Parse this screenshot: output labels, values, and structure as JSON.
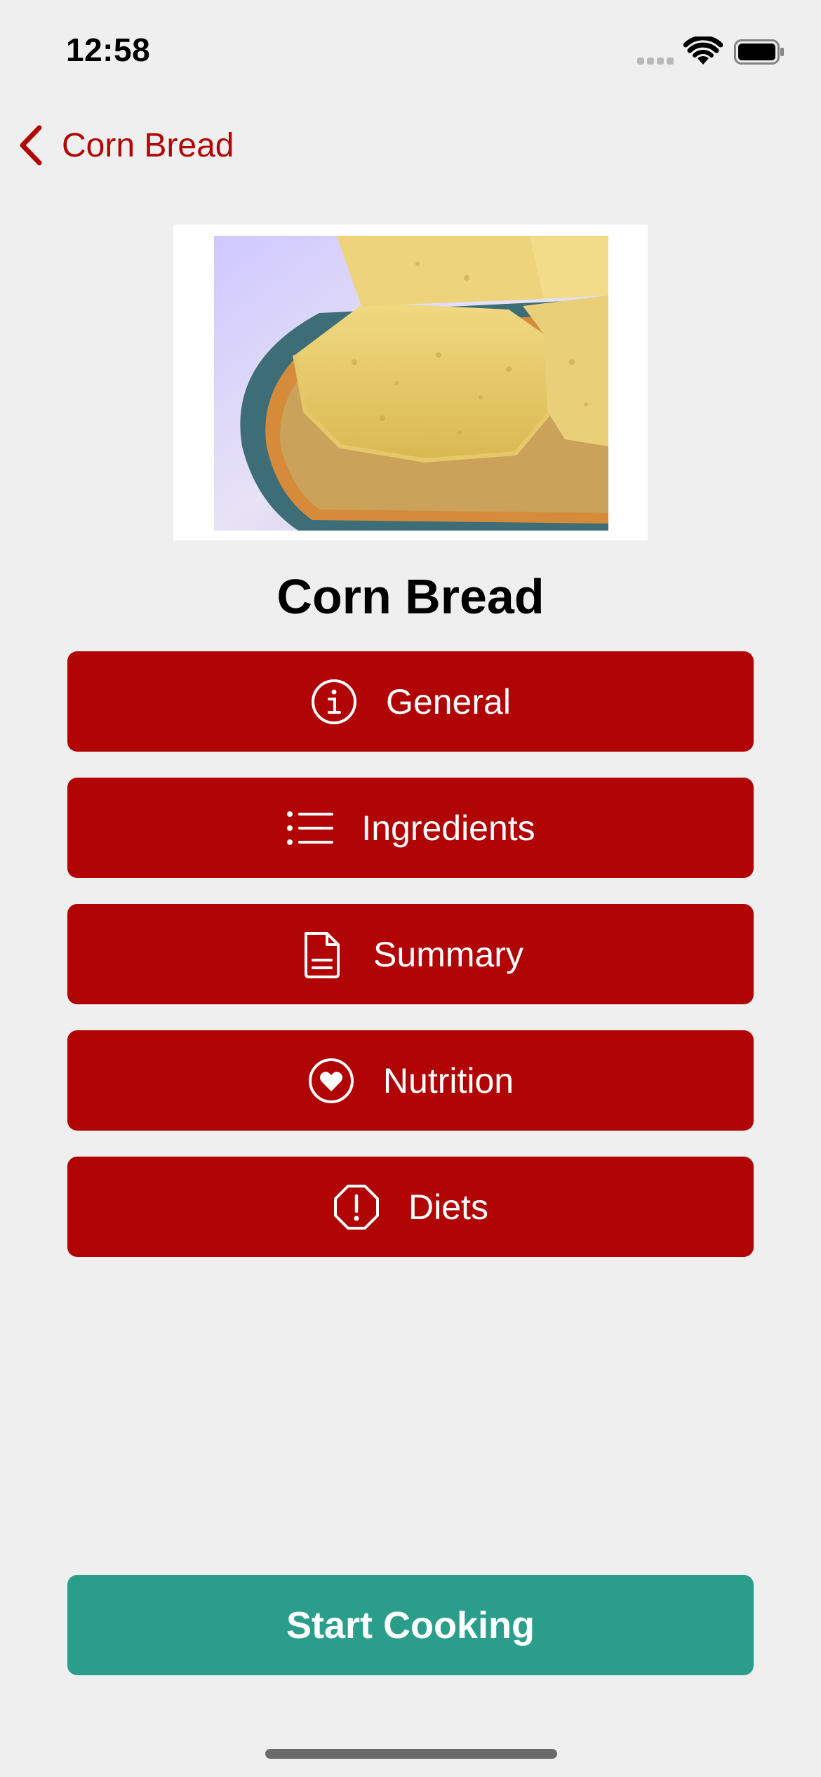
{
  "status_bar": {
    "time": "12:58",
    "icons": [
      "cellular-signal-icon",
      "wifi-icon",
      "battery-icon"
    ]
  },
  "nav": {
    "back_label": "Corn Bread",
    "back_icon": "chevron-left-icon"
  },
  "recipe": {
    "title": "Corn Bread",
    "image": "cornbread-photo"
  },
  "sections": [
    {
      "label": "General",
      "icon": "info-circle-icon"
    },
    {
      "label": "Ingredients",
      "icon": "list-bullet-icon"
    },
    {
      "label": "Summary",
      "icon": "document-icon"
    },
    {
      "label": "Nutrition",
      "icon": "heart-circle-icon"
    },
    {
      "label": "Diets",
      "icon": "exclamation-octagon-icon"
    }
  ],
  "start_button": {
    "label": "Start Cooking"
  },
  "colors": {
    "accent": "#b10505",
    "primary_action": "#2a9e8b",
    "background": "#efefef"
  }
}
